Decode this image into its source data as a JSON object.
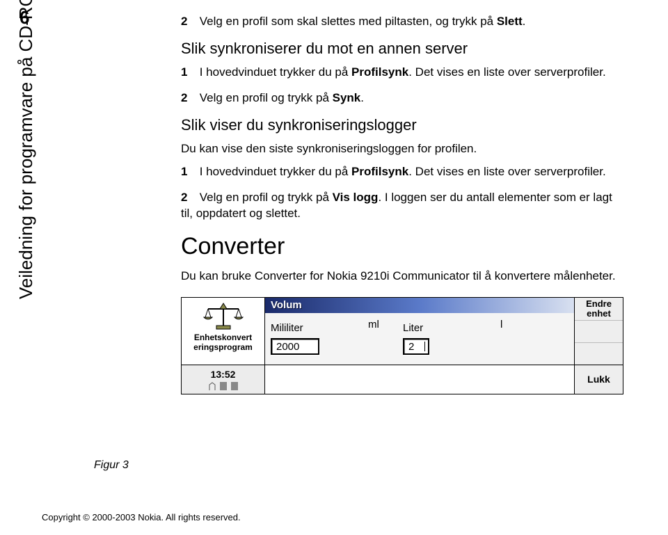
{
  "page_number": "6",
  "sidebar_title": "Veiledning for programvare på CD-ROM",
  "s1": {
    "n": "2",
    "pre": "Velg en profil som skal slettes med piltasten, og trykk på ",
    "bold": "Slett",
    "post": "."
  },
  "h3a": "Slik synkroniserer du mot en annen server",
  "s2": {
    "n": "1",
    "pre": "I hovedvinduet trykker du på ",
    "bold": "Profilsynk",
    "post": ". Det vises en liste over serverprofiler."
  },
  "s3": {
    "n": "2",
    "pre": "Velg en profil og trykk på ",
    "bold": "Synk",
    "post": "."
  },
  "h3b": "Slik viser du synkroniseringslogger",
  "p1": "Du kan vise den siste synkroniseringsloggen for profilen.",
  "s4": {
    "n": "1",
    "pre": "I hovedvinduet trykker du på ",
    "bold": "Profilsynk",
    "post": ". Det vises en liste over serverprofiler."
  },
  "s5": {
    "n": "2",
    "pre": "Velg en profil og trykk på ",
    "bold": "Vis logg",
    "post": ". I loggen ser du antall elementer som er lagt til, oppdatert og slettet."
  },
  "h2": "Converter",
  "p2": "Du kan bruke Converter for Nokia 9210i Communicator til å konvertere målenheter.",
  "device": {
    "left_line1": "Enhetskonvert",
    "left_line2": "eringsprogram",
    "title": "Volum",
    "from_label": "Mililiter",
    "from_unit": "ml",
    "from_value": "2000",
    "to_label": "Liter",
    "to_unit": "l",
    "to_value": "2",
    "softkey1a": "Endre",
    "softkey1b": "enhet",
    "time": "13:52",
    "rightkey": "Lukk"
  },
  "figure_label": "Figur 3",
  "copyright": "Copyright © 2000-2003 Nokia. All rights reserved."
}
